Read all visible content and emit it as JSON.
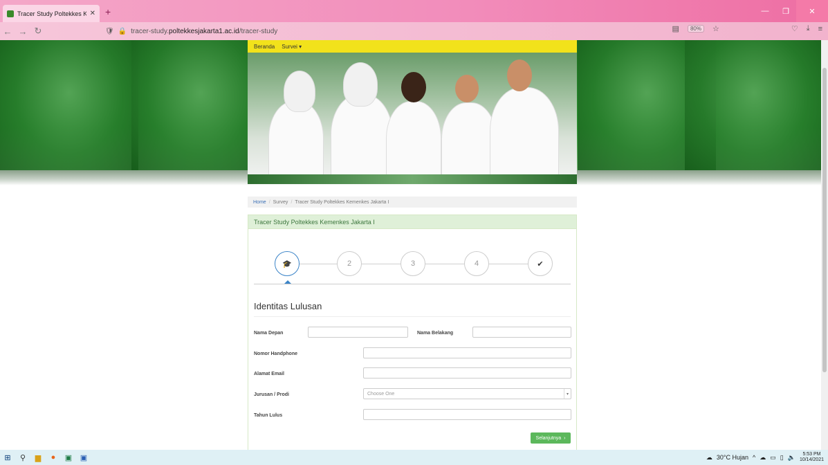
{
  "browser": {
    "tab_title": "Tracer Study Poltekkes Kemenk...",
    "tab_close": "✕",
    "new_tab": "+",
    "url_prefix": "tracer-study.",
    "url_domain": "poltekkesjakarta1.ac.id",
    "url_path": "/tracer-study",
    "zoom": "80%"
  },
  "site_nav": {
    "home": "Beranda",
    "survey": "Survei ▾"
  },
  "breadcrumb": {
    "home": "Home",
    "survey": "Survey",
    "current": "Tracer Study Poltekkes Kemenkes Jakarta I",
    "separator": "/"
  },
  "panel": {
    "title": "Tracer Study Poltekkes Kemenkes Jakarta I"
  },
  "wizard": {
    "steps": [
      "",
      "2",
      "3",
      "4",
      "✔"
    ],
    "active_index": 0
  },
  "form": {
    "section_title": "Identitas Lulusan",
    "first_name_label": "Nama Depan",
    "last_name_label": "Nama Belakang",
    "phone_label": "Nomor Handphone",
    "email_label": "Alamat Email",
    "major_label": "Jurusan / Prodi",
    "major_placeholder": "Choose One",
    "year_label": "Tahun Lulus",
    "next_button": "Selanjutnya"
  },
  "taskbar": {
    "weather": "30°C Hujan",
    "time": "5:53 PM",
    "date": "10/14/2021"
  },
  "colors": {
    "accent_blue": "#3b84c8",
    "success_green": "#5cb85c",
    "panel_green": "#dff0d8",
    "menu_yellow": "#f2e21b"
  }
}
